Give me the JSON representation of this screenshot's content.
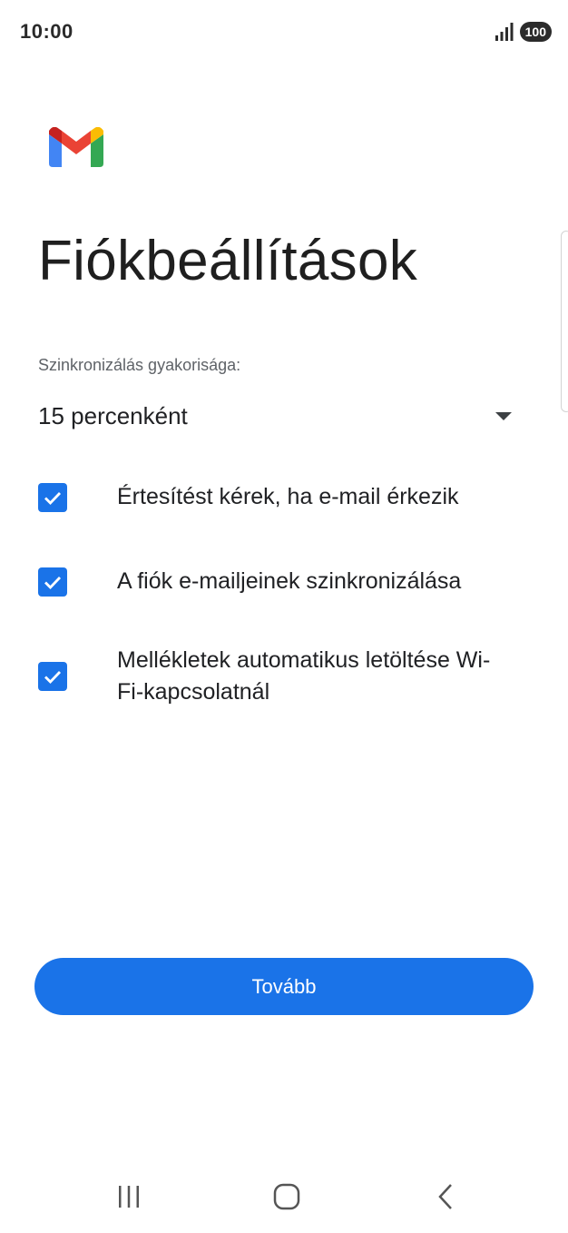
{
  "status_bar": {
    "time": "10:00",
    "battery": "100",
    "signal_icon": "signal-bars-icon"
  },
  "app": {
    "logo": "gmail-logo-icon",
    "colors": {
      "accent": "#1a73e8",
      "logo_red": "#ea4335",
      "logo_blue": "#4285f4",
      "logo_green": "#34a853",
      "logo_yellow": "#fbbc04",
      "logo_dark_red": "#c5221f"
    }
  },
  "page": {
    "title": "Fiókbeállítások"
  },
  "sync": {
    "label": "Szinkronizálás gyakorisága:",
    "selected": "15 percenként"
  },
  "options": [
    {
      "label": "Értesítést kérek, ha e-mail érkezik",
      "checked": true
    },
    {
      "label": "A fiók e-mailjeinek szinkronizálása",
      "checked": true
    },
    {
      "label": "Mellékletek automatikus letöltése Wi-Fi-kapcsolatnál",
      "checked": true
    }
  ],
  "next_button": {
    "label": "Tovább"
  },
  "nav": {
    "recents": "recents-icon",
    "home": "home-icon",
    "back": "back-icon"
  }
}
